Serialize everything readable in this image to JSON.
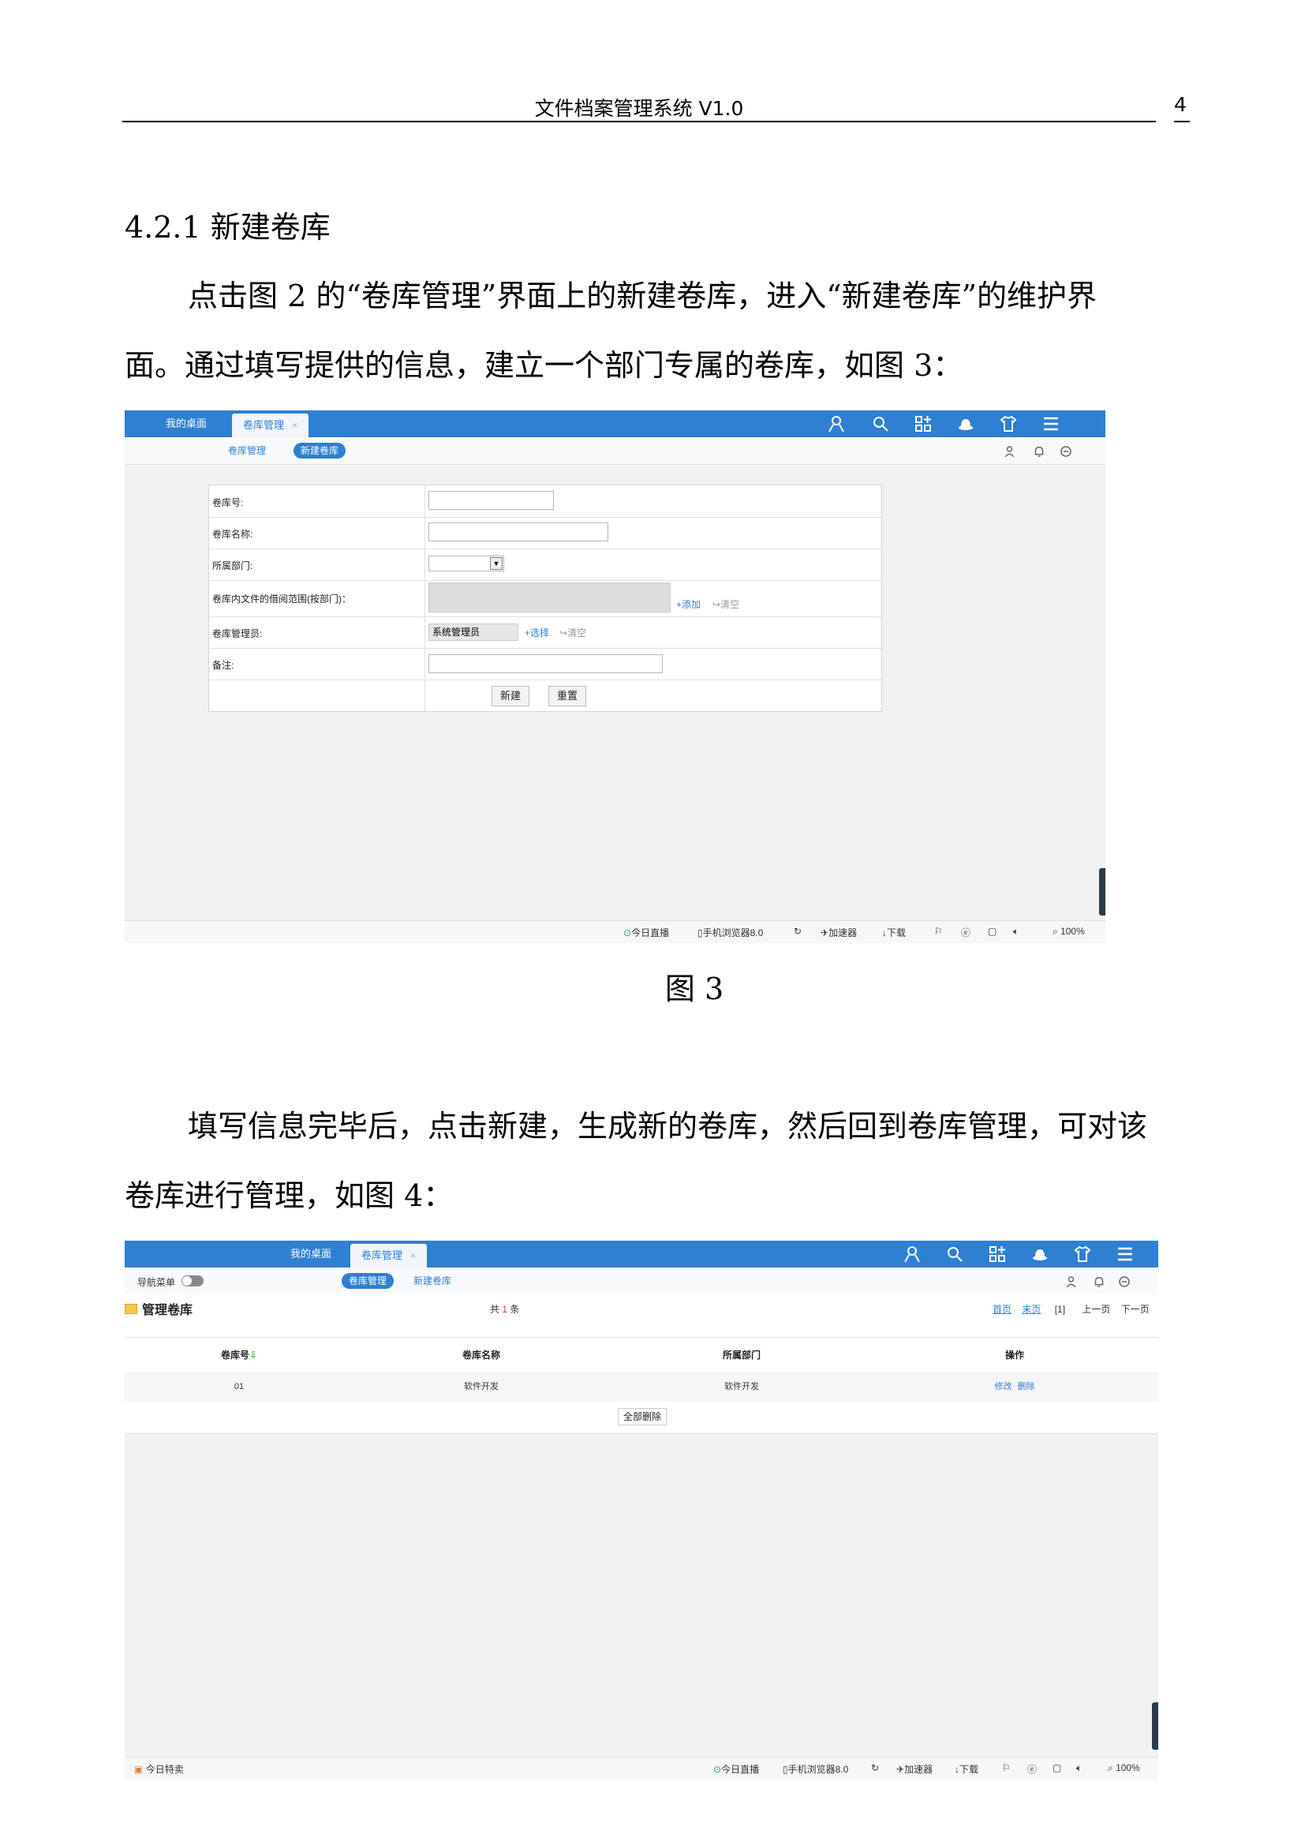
{
  "header": {
    "title": "文件档案管理系统 V1.0",
    "page_number": "4"
  },
  "section": {
    "heading": "4.2.1 新建卷库"
  },
  "paragraph1": {
    "line1": "点击图 2 的“卷库管理”界面上的新建卷库，进入“新建卷库”的维护界",
    "line2": "面。通过填写提供的信息，建立一个部门专属的卷库，如图 3："
  },
  "figure3": {
    "caption": "图 3",
    "tabs": {
      "desktop": "我的桌面",
      "active": "卷库管理",
      "close": "×"
    },
    "subtabs": {
      "manage": "卷库管理",
      "new": "新建卷库"
    },
    "form": {
      "label_number": "卷库号:",
      "label_name": "卷库名称:",
      "label_dept": "所属部门:",
      "label_scope": "卷库内文件的借阅范围(按部门)：",
      "label_admin": "卷库管理员:",
      "label_note": "备注:",
      "admin_value": "系统管理员",
      "add_link": "+添加",
      "clear_link": "↪清空",
      "select_link": "+选择",
      "clear_link2": "↪清空",
      "create_button": "新建",
      "reset_button": "重置"
    },
    "status": {
      "live": "今日直播",
      "browser": "手机浏览器8.0",
      "accelerator": "加速器",
      "download": "下载",
      "zoom": "100%"
    }
  },
  "paragraph2": {
    "line1": "填写信息完毕后，点击新建，生成新的卷库，然后回到卷库管理，可对该",
    "line2": "卷库进行管理，如图 4："
  },
  "figure4": {
    "tabs": {
      "desktop": "我的桌面",
      "active": "卷库管理",
      "close": "×"
    },
    "nav_menu_label": "导航菜单",
    "subtabs": {
      "manage": "卷库管理",
      "new": "新建卷库"
    },
    "panel_title": "管理卷库",
    "total": {
      "prefix": "共",
      "count": "1",
      "suffix": "条"
    },
    "pager": {
      "first": "首页",
      "last": "末页",
      "current": "[1]",
      "prev": "上一页",
      "next": "下一页"
    },
    "table": {
      "headers": [
        "卷库号",
        "卷库名称",
        "所属部门",
        "操作"
      ],
      "rows": [
        {
          "id": "01",
          "name": "软件开发",
          "dept": "软件开发",
          "edit": "修改",
          "delete": "删除"
        }
      ]
    },
    "delete_all_button": "全部删除",
    "status": {
      "special": "今日特卖",
      "live": "今日直播",
      "browser": "手机浏览器8.0",
      "accelerator": "加速器",
      "download": "下载",
      "zoom": "100%"
    }
  }
}
